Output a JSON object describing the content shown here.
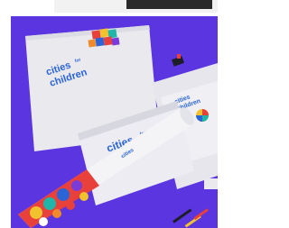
{
  "scene": {
    "description_colors": {
      "background": "#5b35e0",
      "paper": "#e9e9ee",
      "brand_blue": "#2a64d6",
      "accent_red": "#e8403a",
      "accent_yellow": "#f2c12e",
      "accent_teal": "#1fb5a8"
    }
  },
  "brand": {
    "name": "cities for children",
    "line1": "cities",
    "line2": "for",
    "line3": "children"
  }
}
